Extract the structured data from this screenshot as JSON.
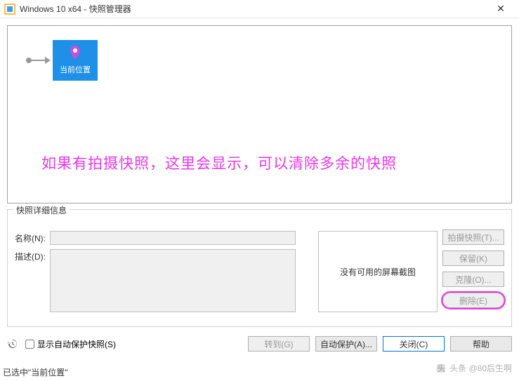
{
  "titlebar": {
    "title": "Windows 10 x64 - 快照管理器"
  },
  "tree": {
    "current_label": "当前位置"
  },
  "annotation_text": "如果有拍摄快照，这里会显示，可以清除多余的快照",
  "details": {
    "group_label": "快照详细信息",
    "name_label": "名称(N):",
    "name_value": "",
    "desc_label": "描述(D):",
    "desc_value": "",
    "thumb_text": "没有可用的屏幕截图"
  },
  "side_buttons": {
    "take": "拍摄快照(T)...",
    "keep": "保留(K)",
    "clone": "克隆(O)...",
    "delete": "删除(E)"
  },
  "bottom": {
    "autoprotect_chk": "显示自动保护快照(S)",
    "goto": "转到(G)",
    "autoprotect_btn": "自动保护(A)...",
    "close": "关闭(C)",
    "help": "帮助"
  },
  "status_text": "已选中\"当前位置\"",
  "watermark": "头条 @80后生啊"
}
